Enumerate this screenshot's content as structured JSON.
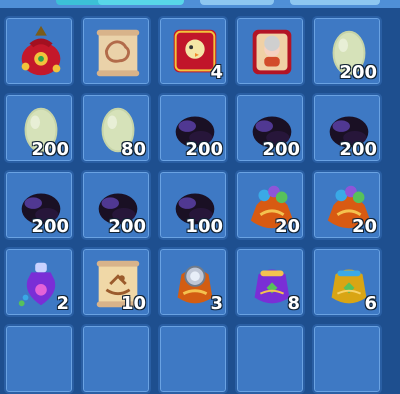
{
  "inventory": {
    "rows": [
      [
        {
          "icon": "red-gift-pouch-icon",
          "qty": ""
        },
        {
          "icon": "treasure-map-scroll-icon",
          "qty": ""
        },
        {
          "icon": "chick-red-card-icon",
          "qty": "4"
        },
        {
          "icon": "character-portrait-card-icon",
          "qty": ""
        },
        {
          "icon": "pale-green-egg-icon",
          "qty": "200"
        }
      ],
      [
        {
          "icon": "pale-green-egg-icon",
          "qty": "200"
        },
        {
          "icon": "pale-green-egg-icon",
          "qty": "80"
        },
        {
          "icon": "purple-black-gem-icon",
          "qty": "200"
        },
        {
          "icon": "purple-black-gem-icon",
          "qty": "200"
        },
        {
          "icon": "purple-black-gem-icon",
          "qty": "200"
        }
      ],
      [
        {
          "icon": "purple-black-gem-icon",
          "qty": "200"
        },
        {
          "icon": "purple-black-gem-icon",
          "qty": "200"
        },
        {
          "icon": "purple-black-gem-icon",
          "qty": "100"
        },
        {
          "icon": "orange-treasure-sack-icon",
          "qty": "20"
        },
        {
          "icon": "orange-treasure-sack-icon",
          "qty": "20"
        }
      ],
      [
        {
          "icon": "purple-potion-bottle-icon",
          "qty": "2"
        },
        {
          "icon": "rocking-horse-scroll-icon",
          "qty": "10"
        },
        {
          "icon": "orange-pouch-with-mirror-icon",
          "qty": "3"
        },
        {
          "icon": "purple-drawstring-bag-icon",
          "qty": "8"
        },
        {
          "icon": "gold-drawstring-bag-icon",
          "qty": "6"
        }
      ],
      [
        {
          "icon": "empty-slot",
          "qty": ""
        },
        {
          "icon": "empty-slot",
          "qty": ""
        },
        {
          "icon": "empty-slot",
          "qty": ""
        },
        {
          "icon": "empty-slot",
          "qty": ""
        },
        {
          "icon": "empty-slot",
          "qty": ""
        }
      ]
    ]
  }
}
